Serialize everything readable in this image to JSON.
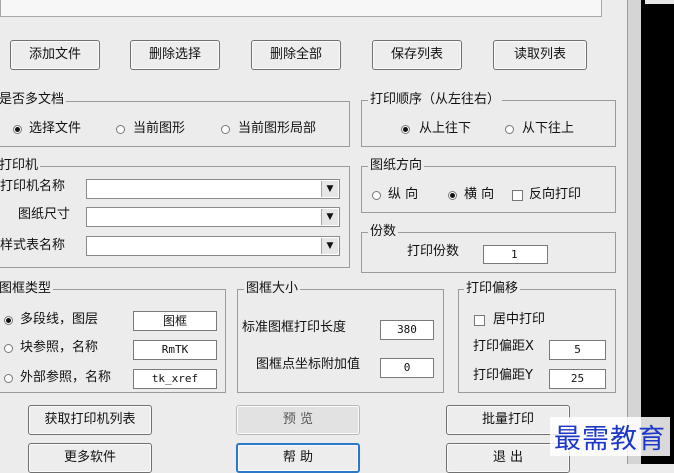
{
  "top_buttons": [
    "添加文件",
    "删除选择",
    "删除全部",
    "保存列表",
    "读取列表"
  ],
  "multi_doc": {
    "title": "是否多文档",
    "options": [
      "选择文件",
      "当前图形",
      "当前图形局部"
    ],
    "selected": "选择文件"
  },
  "print_order": {
    "title": "打印顺序（从左往右）",
    "options": [
      "从上往下",
      "从下往上"
    ],
    "selected": "从上往下"
  },
  "printer": {
    "title": "打印机",
    "printer_name_label": "打印机名称",
    "paper_size_label": "图纸尺寸",
    "style_table_label": "样式表名称",
    "printer_name_value": "",
    "paper_size_value": "",
    "style_table_value": ""
  },
  "orientation": {
    "title": "图纸方向",
    "portrait": "纵 向",
    "landscape": "横 向",
    "reverse": "反向打印",
    "selected": "横 向",
    "reverse_checked": false
  },
  "copies": {
    "title": "份数",
    "label": "打印份数",
    "value": "1"
  },
  "frame_type": {
    "title": "图框类型",
    "options": [
      "多段线，图层",
      "块参照，名称",
      "外部参照，名称"
    ],
    "values": [
      "图框",
      "RmTK",
      "tk_xref"
    ],
    "selected": "多段线，图层"
  },
  "frame_size": {
    "title": "图框大小",
    "length_label": "标准图框打印长度",
    "length_value": "380",
    "offset_label": "图框点坐标附加值",
    "offset_value": "0"
  },
  "print_offset": {
    "title": "打印偏移",
    "center_label": "居中打印",
    "center_checked": false,
    "x_label": "打印偏距X",
    "x_value": "5",
    "y_label": "打印偏距Y",
    "y_value": "25"
  },
  "bottom_buttons": {
    "get_printers": "获取打印机列表",
    "preview": "预 览",
    "batch_print": "批量打印",
    "more_software": "更多软件",
    "help": "帮 助",
    "exit": "退 出"
  },
  "watermark": "最需教育"
}
